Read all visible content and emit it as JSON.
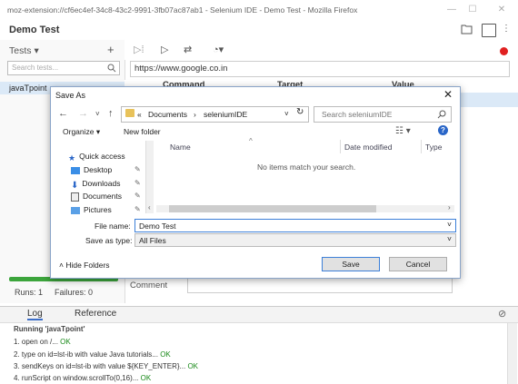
{
  "browser": {
    "title": "moz-extension://cf6ec4ef-34c8-43c2-9991-3fb07ac87ab1 - Selenium IDE - Demo Test - Mozilla Firefox"
  },
  "app": {
    "project_title": "Demo Test"
  },
  "tests_panel": {
    "header": "Tests",
    "dropdown": "▾",
    "add": "+",
    "search_placeholder": "Search tests...",
    "tests": [
      "javaTpoint"
    ],
    "runs_label": "Runs: 1",
    "failures_label": "Failures: 0"
  },
  "editor": {
    "url": "https://www.google.co.in",
    "columns": [
      "Command",
      "Target",
      "Value"
    ],
    "comment_label": "Comment"
  },
  "log_panel": {
    "tabs": [
      "Log",
      "Reference"
    ],
    "running": "Running 'javaTpoint'",
    "lines": [
      {
        "text": "1.  open on /...",
        "status": "OK"
      },
      {
        "text": "2.  type on id=lst-ib with value Java tutorials...",
        "status": "OK"
      },
      {
        "text": "3.  sendKeys on id=lst-ib with value ${KEY_ENTER}...",
        "status": "OK"
      },
      {
        "text": "4.  runScript on window.scrollTo(0,16)...",
        "status": "OK"
      }
    ]
  },
  "dialog": {
    "title": "Save As",
    "path_prefix": "«",
    "path": [
      "Documents",
      "seleniumIDE"
    ],
    "path_sep": "›",
    "search_placeholder": "Search seleniumIDE",
    "organize": "Organize ▾",
    "new_folder": "New folder",
    "nav_items": [
      "Quick access",
      "Desktop",
      "Downloads",
      "Documents",
      "Pictures"
    ],
    "columns": [
      "Name",
      "Date modified",
      "Type"
    ],
    "empty_message": "No items match your search.",
    "file_name_label": "File name:",
    "file_name_value": "Demo Test",
    "save_type_label": "Save as type:",
    "save_type_value": "All Files",
    "hide_folders": "Hide Folders",
    "save": "Save",
    "cancel": "Cancel"
  },
  "colors": {
    "accent": "#3c7fd8",
    "ok_green": "#1a8a1a",
    "record_red": "#e02020",
    "progress_green": "#3ca53c",
    "selection": "#dbe9f7"
  }
}
